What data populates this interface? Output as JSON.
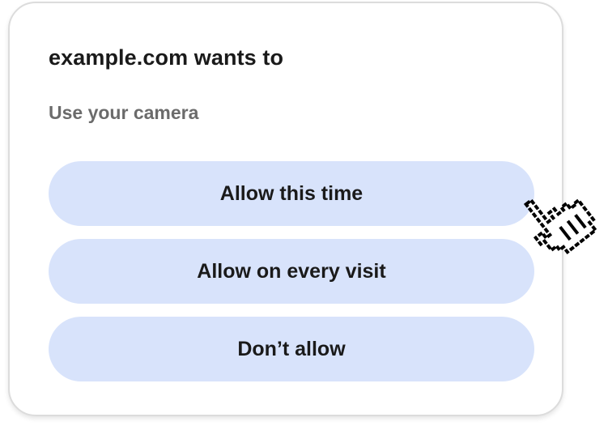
{
  "dialog": {
    "title": "example.com wants to",
    "permission": "Use your camera"
  },
  "buttons": {
    "allow_once": "Allow this time",
    "allow_always": "Allow on every visit",
    "deny": "Don’t allow"
  },
  "colors": {
    "button_bg": "#d8e3fb",
    "text": "#1a1a1a",
    "subtext": "#6b6b6b"
  },
  "icons": {
    "cursor": "pointing-hand-cursor-icon"
  }
}
